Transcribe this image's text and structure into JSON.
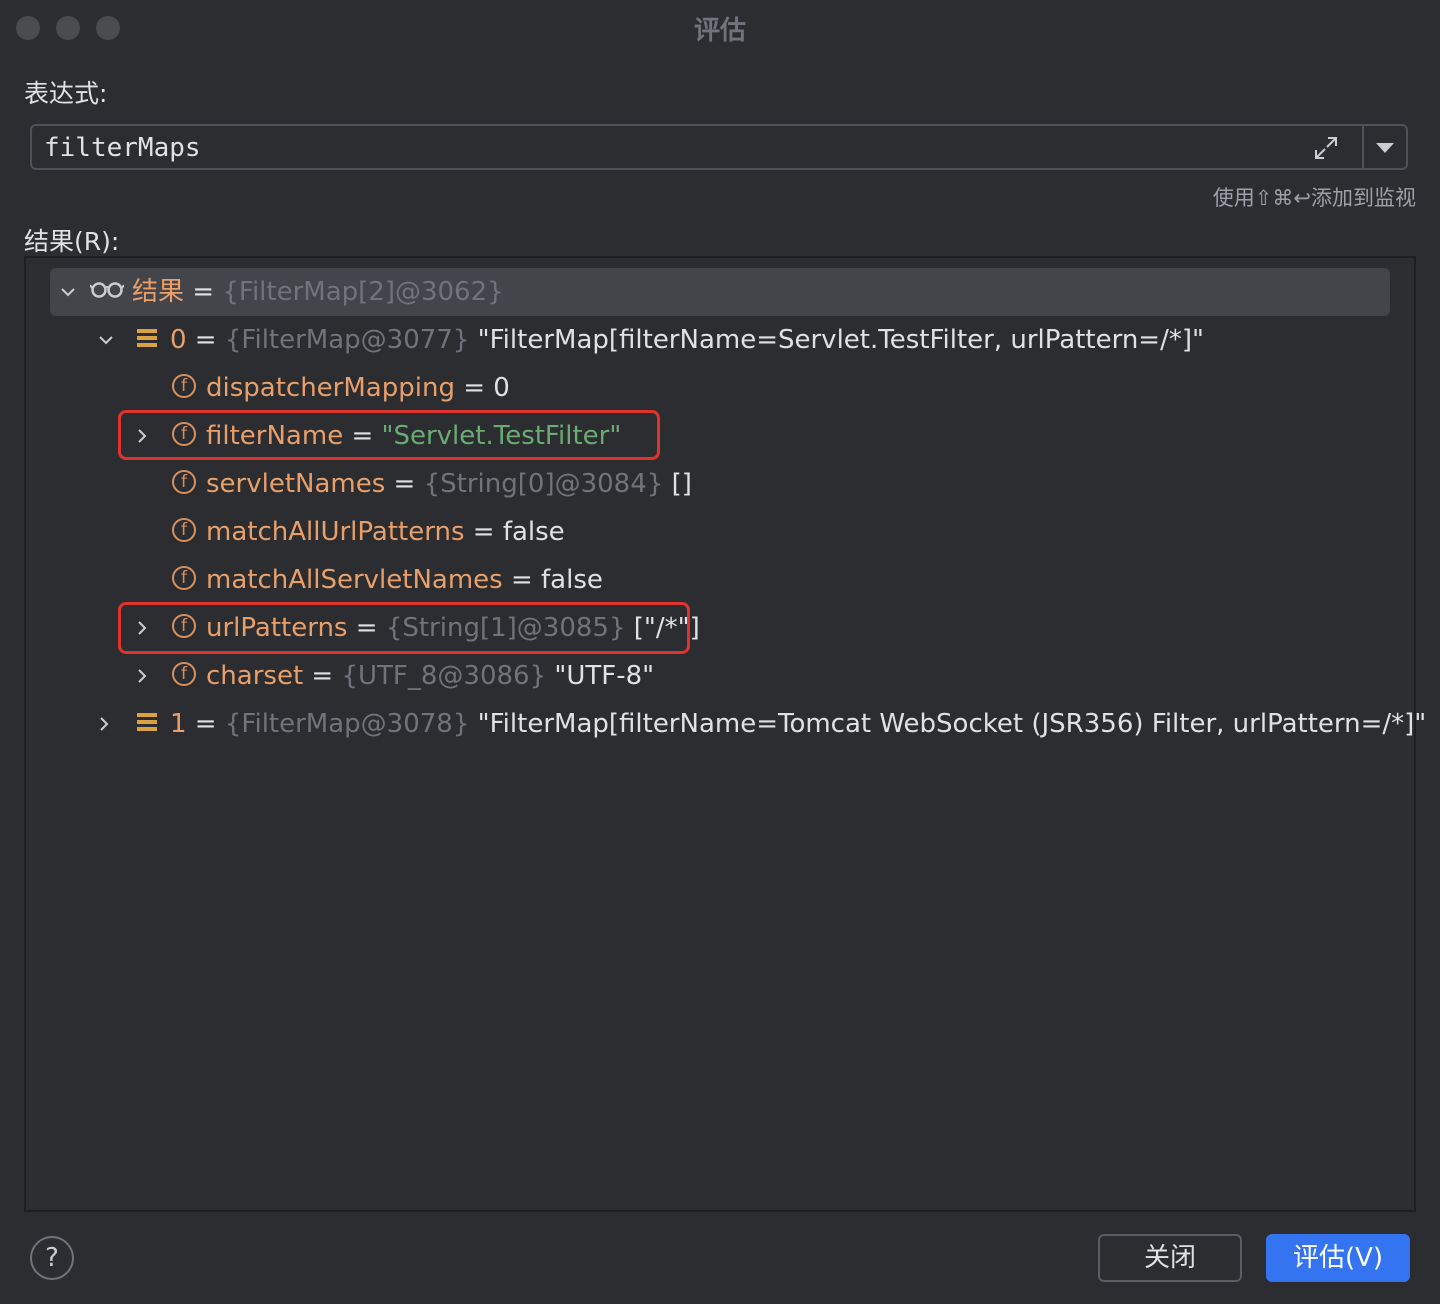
{
  "window": {
    "title": "评估"
  },
  "expression": {
    "label": "表达式:",
    "value": "filterMaps",
    "hint": "使用⇧⌘↩添加到监视"
  },
  "result": {
    "label": "结果(R):",
    "rows": [
      {
        "name": "结果",
        "eq": " = ",
        "type": "{FilterMap[2]@3062}",
        "value": ""
      },
      {
        "name": "0",
        "eq": " = ",
        "type": "{FilterMap@3077}",
        "value": " \"FilterMap[filterName=Servlet.TestFilter, urlPattern=/*]\""
      },
      {
        "name": "dispatcherMapping",
        "eq": " = ",
        "type": "",
        "value": "0"
      },
      {
        "name": "filterName",
        "eq": " = ",
        "type": "",
        "value": "\"Servlet.TestFilter\""
      },
      {
        "name": "servletNames",
        "eq": " = ",
        "type": "{String[0]@3084}",
        "value": " []"
      },
      {
        "name": "matchAllUrlPatterns",
        "eq": " = ",
        "type": "",
        "value": "false"
      },
      {
        "name": "matchAllServletNames",
        "eq": " = ",
        "type": "",
        "value": "false"
      },
      {
        "name": "urlPatterns",
        "eq": " = ",
        "type": "{String[1]@3085}",
        "value": " [\"/*\"]"
      },
      {
        "name": "charset",
        "eq": " = ",
        "type": "{UTF_8@3086}",
        "value": " \"UTF-8\""
      },
      {
        "name": "1",
        "eq": " = ",
        "type": "{FilterMap@3078}",
        "value": " \"FilterMap[filterName=Tomcat WebSocket (JSR356) Filter, urlPattern=/*]\""
      }
    ]
  },
  "icons": {
    "field": "f",
    "help": "?"
  },
  "buttons": {
    "close": "关闭",
    "evaluate": "评估(V)"
  },
  "colors": {
    "accent": "#3574f0",
    "highlight": "#e0332f",
    "field_name": "#e89f6a",
    "string": "#6aab73"
  }
}
